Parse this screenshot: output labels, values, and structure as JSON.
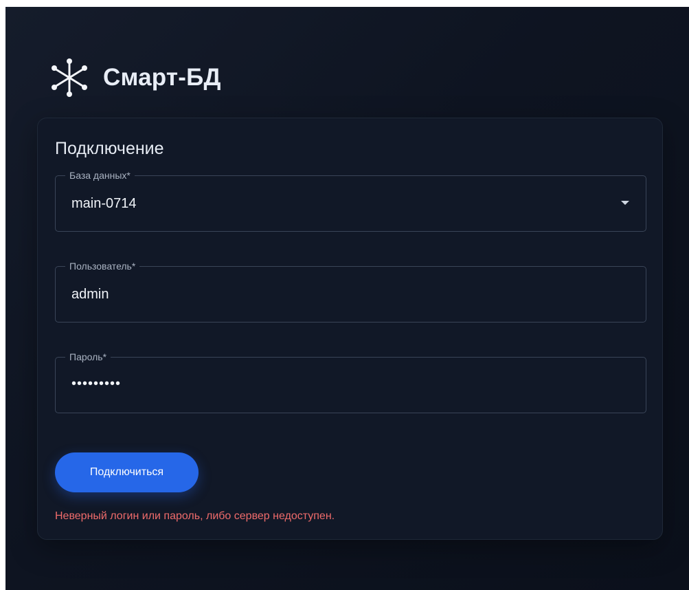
{
  "brand": {
    "title": "Смарт-БД",
    "icon": "asterisk-node-icon"
  },
  "form": {
    "title": "Подключение",
    "database": {
      "label": "База данных*",
      "value": "main-0714",
      "icon": "chevron-down-icon"
    },
    "user": {
      "label": "Пользователь*",
      "value": "admin"
    },
    "password": {
      "label": "Пароль*",
      "value": "•••••••••"
    },
    "submit_label": "Подключиться",
    "error": "Неверный логин или пароль, либо сервер недоступен."
  },
  "colors": {
    "accent": "#2667e8",
    "error": "#ef6b6b",
    "card": "#111827",
    "background": "#0e1421"
  }
}
